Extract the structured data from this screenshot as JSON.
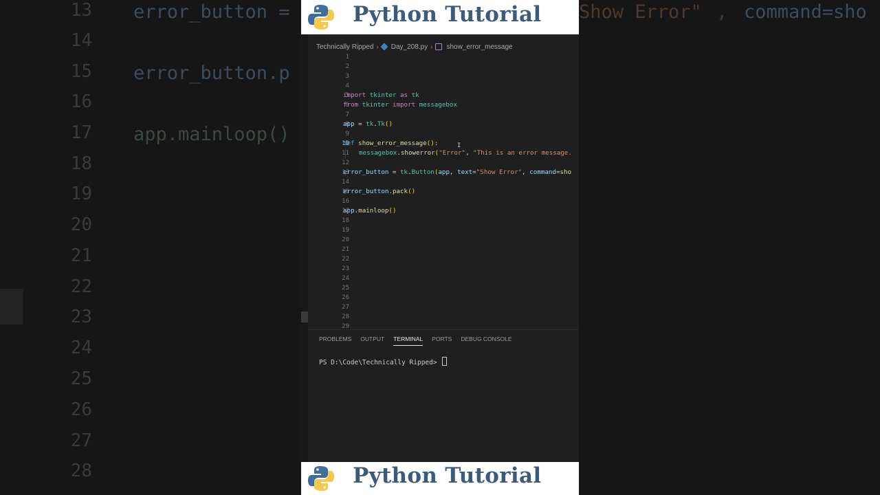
{
  "branding": {
    "title": "Python Tutorial",
    "logo_icon": "python-logo-icon",
    "title_color": "#3c5a79"
  },
  "breadcrumb": {
    "folder": "Technically Ripped",
    "file": "Day_208.py",
    "symbol": "show_error_message"
  },
  "editor": {
    "line_numbers": [
      "1",
      "2",
      "3",
      "4",
      "5",
      "6",
      "7",
      "8",
      "9",
      "10",
      "11",
      "12",
      "13",
      "14",
      "15",
      "16",
      "17",
      "18",
      "19",
      "20",
      "21",
      "22",
      "23",
      "24",
      "25",
      "26",
      "27",
      "28",
      "29"
    ],
    "active_line": "10",
    "lines": {
      "l5": {
        "t1": "import",
        "t2": " tkinter ",
        "t3": "as",
        "t4": " tk"
      },
      "l6": {
        "t1": "from",
        "t2": " tkinter ",
        "t3": "import",
        "t4": " messagebox"
      },
      "l8": {
        "t1": "app",
        "t2": " = ",
        "t3": "tk",
        "t4": ".",
        "t5": "Tk",
        "t6": "()"
      },
      "l10": {
        "t1": "def",
        "t2": " ",
        "t3": "show_error_message",
        "t4": "():"
      },
      "l11": {
        "t1": "messagebox",
        "t2": ".",
        "t3": "showerror",
        "t4": "(",
        "t5": "\"Error\"",
        "t6": ", ",
        "t7": "\"This is an error message."
      },
      "l13": {
        "t1": "error_button",
        "t2": " = ",
        "t3": "tk",
        "t4": ".",
        "t5": "Button",
        "t6": "(",
        "t7": "app",
        "t8": ", ",
        "t9": "text",
        "t10": "=",
        "t11": "\"Show Error\"",
        "t12": ", ",
        "t13": "command",
        "t14": "=",
        "t15": "sho"
      },
      "l15": {
        "t1": "error_button",
        "t2": ".",
        "t3": "pack",
        "t4": "()"
      },
      "l17": {
        "t1": "app",
        "t2": ".",
        "t3": "mainloop",
        "t4": "()"
      }
    }
  },
  "panel_tabs": [
    "PROBLEMS",
    "OUTPUT",
    "TERMINAL",
    "PORTS",
    "DEBUG CONSOLE"
  ],
  "active_tab": "TERMINAL",
  "terminal": {
    "prompt": "PS D:\\Code\\Technically Ripped> "
  },
  "background": {
    "numbers": [
      "13",
      "14",
      "15",
      "16",
      "17",
      "18",
      "19",
      "20",
      "21",
      "22",
      "23",
      "24",
      "25",
      "26",
      "27",
      "28"
    ],
    "code_13": "error_button = ",
    "code_15": "error_button.p",
    "code_17": "app.mainloop()",
    "right_13a": "Show Error\"",
    "right_13b": ", ",
    "right_13c": "command=sho"
  }
}
